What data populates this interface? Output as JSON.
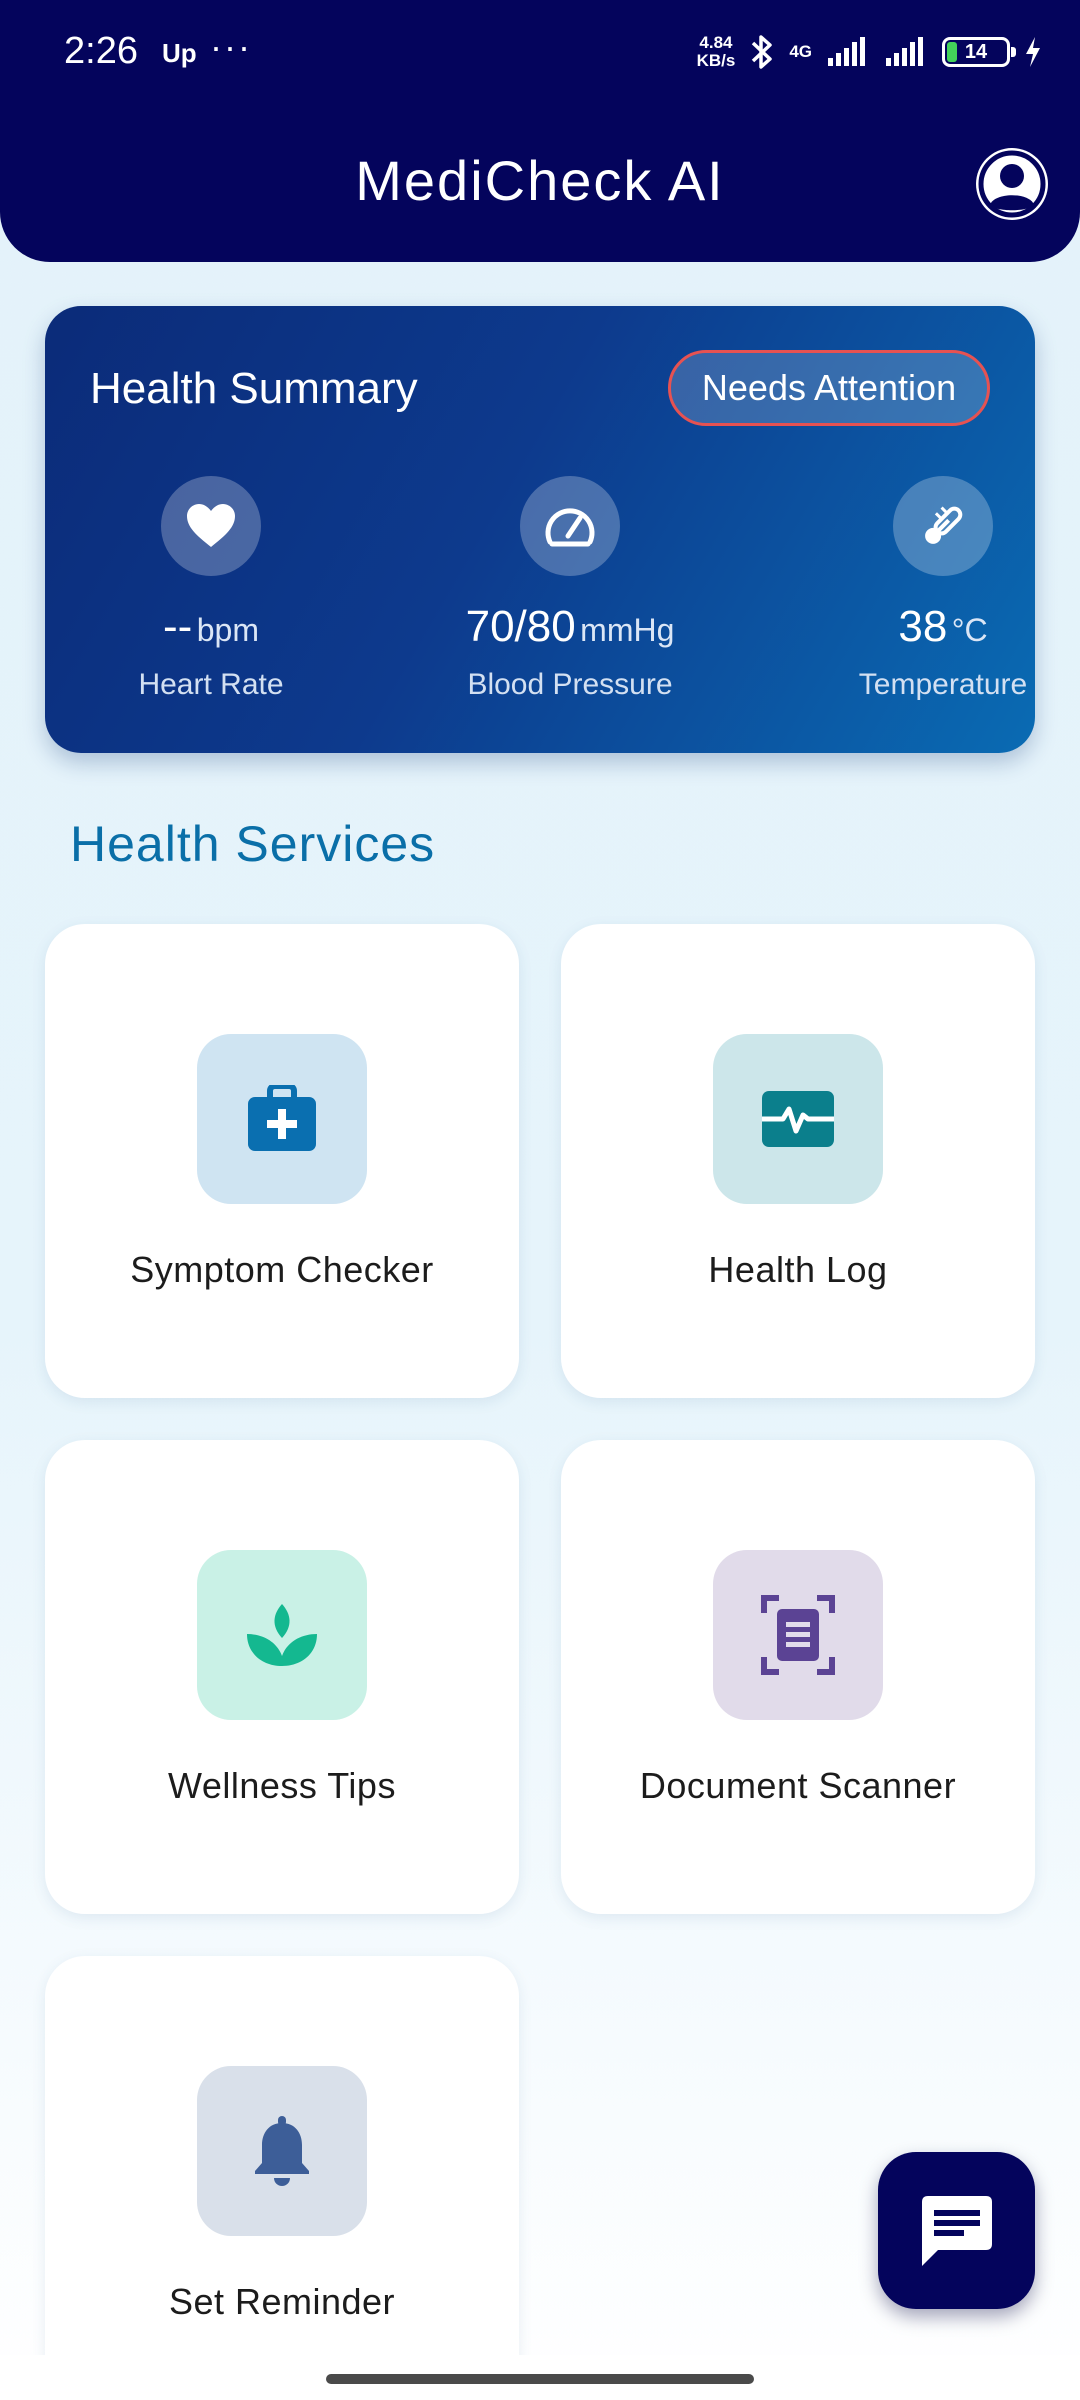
{
  "status_bar": {
    "time": "2:26",
    "app_indicator": "Up",
    "dots": "···",
    "net_speed_value": "4.84",
    "net_speed_unit": "KB/s",
    "network": "4G",
    "battery": "14"
  },
  "header": {
    "title": "MediCheck AI",
    "profile_icon": "account-circle-icon"
  },
  "summary": {
    "title": "Health Summary",
    "badge": "Needs Attention",
    "badge_color": "#e65252",
    "metrics": [
      {
        "icon": "heart-icon",
        "value": "--",
        "unit": "bpm",
        "label": "Heart Rate"
      },
      {
        "icon": "speedometer-icon",
        "value": "70/80",
        "unit": "mmHg",
        "label": "Blood Pressure"
      },
      {
        "icon": "thermometer-icon",
        "value": "38",
        "unit": "°C",
        "label": "Temperature"
      }
    ]
  },
  "services": {
    "title": "Health Services",
    "items": [
      {
        "label": "Symptom Checker",
        "icon": "medical-kit-icon",
        "color": "#0a6fb0"
      },
      {
        "label": "Health Log",
        "icon": "monitor-heart-icon",
        "color": "#0b7f8c"
      },
      {
        "label": "Wellness Tips",
        "icon": "spa-leaf-icon",
        "color": "#14b890"
      },
      {
        "label": "Document Scanner",
        "icon": "document-scanner-icon",
        "color": "#5b4394"
      },
      {
        "label": "Set Reminder",
        "icon": "bell-icon",
        "color": "#3d5e98"
      }
    ]
  },
  "fab": {
    "icon": "chat-icon"
  }
}
